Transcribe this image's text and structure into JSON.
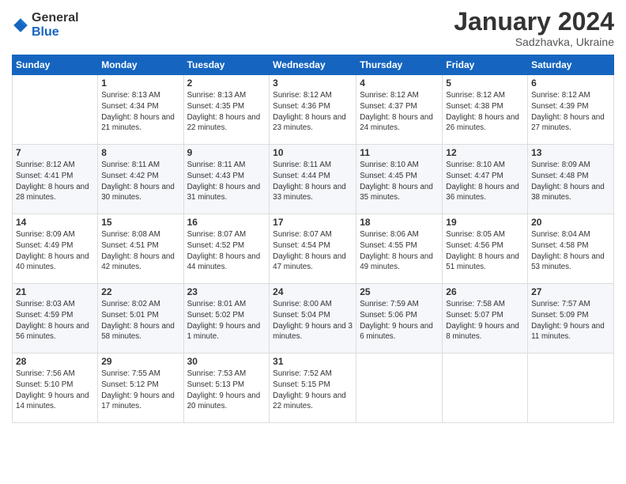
{
  "logo": {
    "general": "General",
    "blue": "Blue"
  },
  "title": {
    "month": "January 2024",
    "location": "Sadzhavka, Ukraine"
  },
  "calendar": {
    "headers": [
      "Sunday",
      "Monday",
      "Tuesday",
      "Wednesday",
      "Thursday",
      "Friday",
      "Saturday"
    ],
    "weeks": [
      [
        {
          "day": "",
          "sunrise": "",
          "sunset": "",
          "daylight": "",
          "empty": true
        },
        {
          "day": "1",
          "sunrise": "Sunrise: 8:13 AM",
          "sunset": "Sunset: 4:34 PM",
          "daylight": "Daylight: 8 hours and 21 minutes."
        },
        {
          "day": "2",
          "sunrise": "Sunrise: 8:13 AM",
          "sunset": "Sunset: 4:35 PM",
          "daylight": "Daylight: 8 hours and 22 minutes."
        },
        {
          "day": "3",
          "sunrise": "Sunrise: 8:12 AM",
          "sunset": "Sunset: 4:36 PM",
          "daylight": "Daylight: 8 hours and 23 minutes."
        },
        {
          "day": "4",
          "sunrise": "Sunrise: 8:12 AM",
          "sunset": "Sunset: 4:37 PM",
          "daylight": "Daylight: 8 hours and 24 minutes."
        },
        {
          "day": "5",
          "sunrise": "Sunrise: 8:12 AM",
          "sunset": "Sunset: 4:38 PM",
          "daylight": "Daylight: 8 hours and 26 minutes."
        },
        {
          "day": "6",
          "sunrise": "Sunrise: 8:12 AM",
          "sunset": "Sunset: 4:39 PM",
          "daylight": "Daylight: 8 hours and 27 minutes."
        }
      ],
      [
        {
          "day": "7",
          "sunrise": "Sunrise: 8:12 AM",
          "sunset": "Sunset: 4:41 PM",
          "daylight": "Daylight: 8 hours and 28 minutes."
        },
        {
          "day": "8",
          "sunrise": "Sunrise: 8:11 AM",
          "sunset": "Sunset: 4:42 PM",
          "daylight": "Daylight: 8 hours and 30 minutes."
        },
        {
          "day": "9",
          "sunrise": "Sunrise: 8:11 AM",
          "sunset": "Sunset: 4:43 PM",
          "daylight": "Daylight: 8 hours and 31 minutes."
        },
        {
          "day": "10",
          "sunrise": "Sunrise: 8:11 AM",
          "sunset": "Sunset: 4:44 PM",
          "daylight": "Daylight: 8 hours and 33 minutes."
        },
        {
          "day": "11",
          "sunrise": "Sunrise: 8:10 AM",
          "sunset": "Sunset: 4:45 PM",
          "daylight": "Daylight: 8 hours and 35 minutes."
        },
        {
          "day": "12",
          "sunrise": "Sunrise: 8:10 AM",
          "sunset": "Sunset: 4:47 PM",
          "daylight": "Daylight: 8 hours and 36 minutes."
        },
        {
          "day": "13",
          "sunrise": "Sunrise: 8:09 AM",
          "sunset": "Sunset: 4:48 PM",
          "daylight": "Daylight: 8 hours and 38 minutes."
        }
      ],
      [
        {
          "day": "14",
          "sunrise": "Sunrise: 8:09 AM",
          "sunset": "Sunset: 4:49 PM",
          "daylight": "Daylight: 8 hours and 40 minutes."
        },
        {
          "day": "15",
          "sunrise": "Sunrise: 8:08 AM",
          "sunset": "Sunset: 4:51 PM",
          "daylight": "Daylight: 8 hours and 42 minutes."
        },
        {
          "day": "16",
          "sunrise": "Sunrise: 8:07 AM",
          "sunset": "Sunset: 4:52 PM",
          "daylight": "Daylight: 8 hours and 44 minutes."
        },
        {
          "day": "17",
          "sunrise": "Sunrise: 8:07 AM",
          "sunset": "Sunset: 4:54 PM",
          "daylight": "Daylight: 8 hours and 47 minutes."
        },
        {
          "day": "18",
          "sunrise": "Sunrise: 8:06 AM",
          "sunset": "Sunset: 4:55 PM",
          "daylight": "Daylight: 8 hours and 49 minutes."
        },
        {
          "day": "19",
          "sunrise": "Sunrise: 8:05 AM",
          "sunset": "Sunset: 4:56 PM",
          "daylight": "Daylight: 8 hours and 51 minutes."
        },
        {
          "day": "20",
          "sunrise": "Sunrise: 8:04 AM",
          "sunset": "Sunset: 4:58 PM",
          "daylight": "Daylight: 8 hours and 53 minutes."
        }
      ],
      [
        {
          "day": "21",
          "sunrise": "Sunrise: 8:03 AM",
          "sunset": "Sunset: 4:59 PM",
          "daylight": "Daylight: 8 hours and 56 minutes."
        },
        {
          "day": "22",
          "sunrise": "Sunrise: 8:02 AM",
          "sunset": "Sunset: 5:01 PM",
          "daylight": "Daylight: 8 hours and 58 minutes."
        },
        {
          "day": "23",
          "sunrise": "Sunrise: 8:01 AM",
          "sunset": "Sunset: 5:02 PM",
          "daylight": "Daylight: 9 hours and 1 minute."
        },
        {
          "day": "24",
          "sunrise": "Sunrise: 8:00 AM",
          "sunset": "Sunset: 5:04 PM",
          "daylight": "Daylight: 9 hours and 3 minutes."
        },
        {
          "day": "25",
          "sunrise": "Sunrise: 7:59 AM",
          "sunset": "Sunset: 5:06 PM",
          "daylight": "Daylight: 9 hours and 6 minutes."
        },
        {
          "day": "26",
          "sunrise": "Sunrise: 7:58 AM",
          "sunset": "Sunset: 5:07 PM",
          "daylight": "Daylight: 9 hours and 8 minutes."
        },
        {
          "day": "27",
          "sunrise": "Sunrise: 7:57 AM",
          "sunset": "Sunset: 5:09 PM",
          "daylight": "Daylight: 9 hours and 11 minutes."
        }
      ],
      [
        {
          "day": "28",
          "sunrise": "Sunrise: 7:56 AM",
          "sunset": "Sunset: 5:10 PM",
          "daylight": "Daylight: 9 hours and 14 minutes."
        },
        {
          "day": "29",
          "sunrise": "Sunrise: 7:55 AM",
          "sunset": "Sunset: 5:12 PM",
          "daylight": "Daylight: 9 hours and 17 minutes."
        },
        {
          "day": "30",
          "sunrise": "Sunrise: 7:53 AM",
          "sunset": "Sunset: 5:13 PM",
          "daylight": "Daylight: 9 hours and 20 minutes."
        },
        {
          "day": "31",
          "sunrise": "Sunrise: 7:52 AM",
          "sunset": "Sunset: 5:15 PM",
          "daylight": "Daylight: 9 hours and 22 minutes."
        },
        {
          "day": "",
          "empty": true
        },
        {
          "day": "",
          "empty": true
        },
        {
          "day": "",
          "empty": true
        }
      ]
    ]
  }
}
